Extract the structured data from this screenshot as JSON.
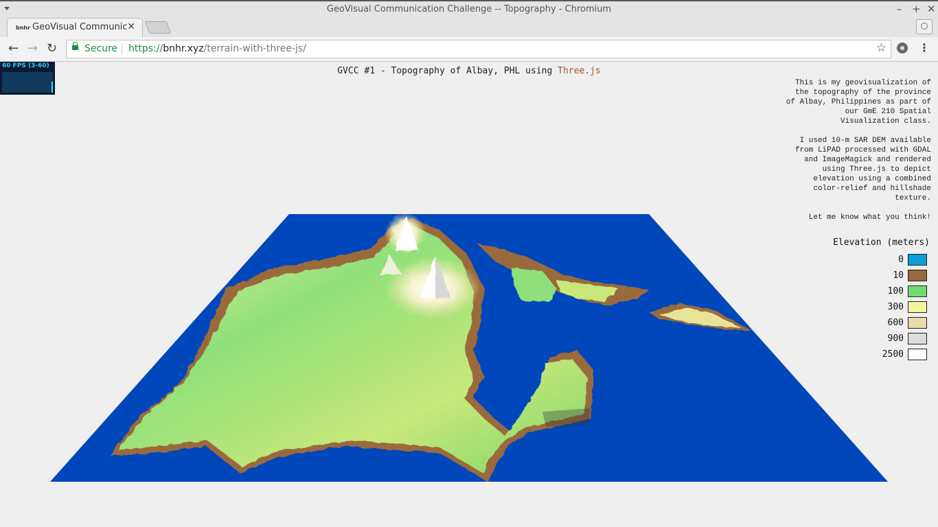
{
  "window": {
    "title": "GeoVisual Communication Challenge -- Topography - Chromium"
  },
  "tab": {
    "favicon_text": "bnhr",
    "title": "GeoVisual Communication Challenge -- Topography"
  },
  "omnibox": {
    "secure_label": "Secure",
    "url_scheme": "https://",
    "url_host": "bnhr.xyz",
    "url_path": "/terrain-with-three-js/"
  },
  "stats": {
    "fps_label": "60 FPS (3-60)"
  },
  "page": {
    "heading_text": "GVCC #1 - Topography of Albay, PHL using ",
    "heading_link": "Three.js",
    "description": [
      "This is my geovisualization of the topography of the province of Albay, Philippines as part of our GmE 210 Spatial Visualization class.",
      "I used 10-m SAR DEM available from LiPAD processed with GDAL and ImageMagick and rendered using Three.js to depict elevation using a combined color-relief and hillshade texture.",
      "Let me know what you think!"
    ]
  },
  "legend": {
    "title": "Elevation (meters)",
    "items": [
      {
        "value": "0",
        "color": "#0a9edc"
      },
      {
        "value": "10",
        "color": "#9a6a3c"
      },
      {
        "value": "100",
        "color": "#6fdc6f"
      },
      {
        "value": "300",
        "color": "#f5f5a0"
      },
      {
        "value": "600",
        "color": "#e8dcaa"
      },
      {
        "value": "900",
        "color": "#dcdcdc"
      },
      {
        "value": "2500",
        "color": "#ffffff"
      }
    ]
  },
  "colors": {
    "sea": "#0047bb",
    "link": "#a0522d"
  }
}
